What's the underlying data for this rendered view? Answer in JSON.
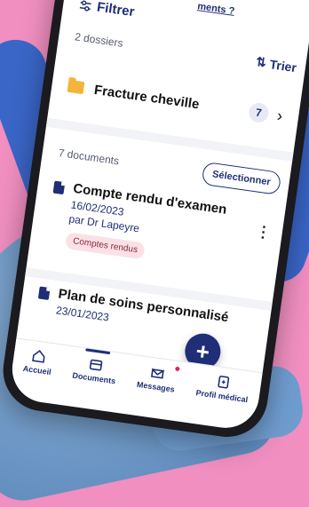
{
  "top_link": "ments ?",
  "filter": {
    "label": "Filtrer",
    "icon": "filter-sliders-icon"
  },
  "folders_count": "2 dossiers",
  "sort": {
    "label": "Trier",
    "icon": "sort-arrows-icon"
  },
  "folder": {
    "name": "Fracture cheville",
    "count": "7"
  },
  "documents_count": "7 documents",
  "select_button": "Sélectionner",
  "documents": [
    {
      "title": "Compte rendu d'examen",
      "date": "16/02/2023",
      "author": "par Dr Lapeyre",
      "tag": "Comptes rendus"
    },
    {
      "title": "Plan de soins personnalisé",
      "date": "23/01/2023"
    }
  ],
  "fab_label": "+",
  "tabs": [
    {
      "label": "Accueil",
      "icon": "home-icon"
    },
    {
      "label": "Documents",
      "icon": "folder-icon",
      "active": true
    },
    {
      "label": "Messages",
      "icon": "message-icon",
      "badge": true
    },
    {
      "label": "Profil médical",
      "icon": "medical-profile-icon"
    }
  ],
  "colors": {
    "accent": "#1f2e77",
    "folder": "#f4b33a",
    "tag_bg": "#fbe1e6",
    "background": "#f08fc0"
  }
}
